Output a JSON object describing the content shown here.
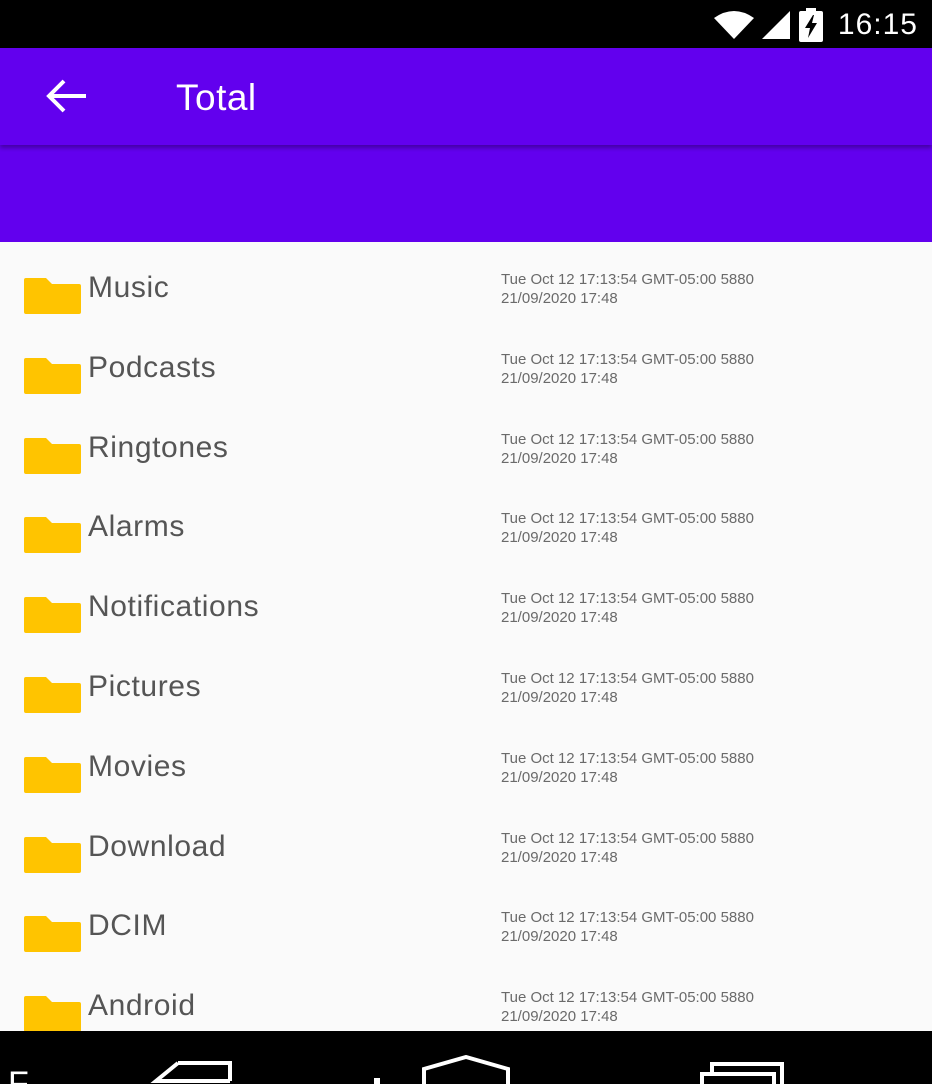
{
  "status_bar": {
    "time": "16:15",
    "icons": [
      "wifi-icon",
      "cell-signal-icon",
      "battery-charging-icon"
    ]
  },
  "app_bar": {
    "back_icon": "arrow-left-icon",
    "title": "Total",
    "color": "#6200ee"
  },
  "folder_icon_color": "#ffc400",
  "files": [
    {
      "name": "Music",
      "meta_line1": "Tue Oct 12 17:13:54 GMT-05:00 5880",
      "meta_line2": "21/09/2020 17:48"
    },
    {
      "name": "Podcasts",
      "meta_line1": "Tue Oct 12 17:13:54 GMT-05:00 5880",
      "meta_line2": "21/09/2020 17:48"
    },
    {
      "name": "Ringtones",
      "meta_line1": "Tue Oct 12 17:13:54 GMT-05:00 5880",
      "meta_line2": "21/09/2020 17:48"
    },
    {
      "name": "Alarms",
      "meta_line1": "Tue Oct 12 17:13:54 GMT-05:00 5880",
      "meta_line2": "21/09/2020 17:48"
    },
    {
      "name": "Notifications",
      "meta_line1": "Tue Oct 12 17:13:54 GMT-05:00 5880",
      "meta_line2": "21/09/2020 17:48"
    },
    {
      "name": "Pictures",
      "meta_line1": "Tue Oct 12 17:13:54 GMT-05:00 5880",
      "meta_line2": "21/09/2020 17:48"
    },
    {
      "name": "Movies",
      "meta_line1": "Tue Oct 12 17:13:54 GMT-05:00 5880",
      "meta_line2": "21/09/2020 17:48"
    },
    {
      "name": "Download",
      "meta_line1": "Tue Oct 12 17:13:54 GMT-05:00 5880",
      "meta_line2": "21/09/2020 17:48"
    },
    {
      "name": "DCIM",
      "meta_line1": "Tue Oct 12 17:13:54 GMT-05:00 5880",
      "meta_line2": "21/09/2020 17:48"
    },
    {
      "name": "Android",
      "meta_line1": "Tue Oct 12 17:13:54 GMT-05:00 5880",
      "meta_line2": "21/09/2020 17:48"
    }
  ],
  "nav_bar": {
    "left_glyph": "F",
    "buttons": [
      "back-icon",
      "home-icon",
      "recents-icon"
    ]
  }
}
